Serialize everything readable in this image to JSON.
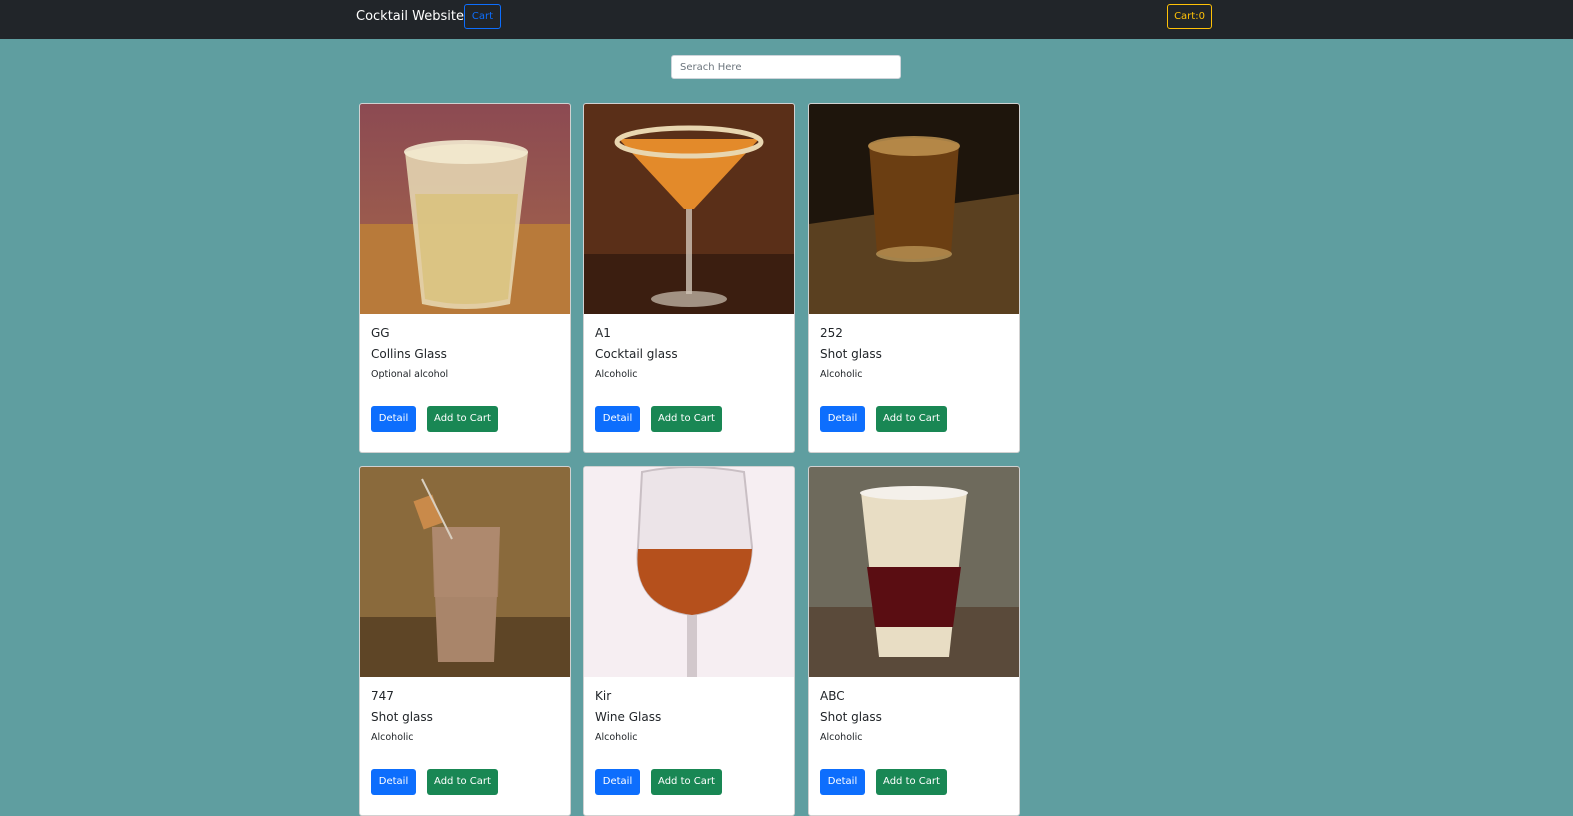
{
  "navbar": {
    "brand": "Cocktail Website",
    "cart_link": "Cart",
    "cart_count": "Cart:0"
  },
  "search": {
    "placeholder": "Serach Here"
  },
  "drinks": [
    {
      "name": "GG",
      "glass": "Collins Glass",
      "alcoholic": "Optional alcohol",
      "detail": "Detail",
      "add": "Add to Cart"
    },
    {
      "name": "A1",
      "glass": "Cocktail glass",
      "alcoholic": "Alcoholic",
      "detail": "Detail",
      "add": "Add to Cart"
    },
    {
      "name": "252",
      "glass": "Shot glass",
      "alcoholic": "Alcoholic",
      "detail": "Detail",
      "add": "Add to Cart"
    },
    {
      "name": "747",
      "glass": "Shot glass",
      "alcoholic": "Alcoholic",
      "detail": "Detail",
      "add": "Add to Cart"
    },
    {
      "name": "Kir",
      "glass": "Wine Glass",
      "alcoholic": "Alcoholic",
      "detail": "Detail",
      "add": "Add to Cart"
    },
    {
      "name": "ABC",
      "glass": "Shot glass",
      "alcoholic": "Alcoholic",
      "detail": "Detail",
      "add": "Add to Cart"
    }
  ],
  "colors": {
    "navbar": "#212529",
    "background": "#5f9ea0",
    "primary": "#0d6efd",
    "success": "#198754",
    "warning": "#ffc107"
  }
}
